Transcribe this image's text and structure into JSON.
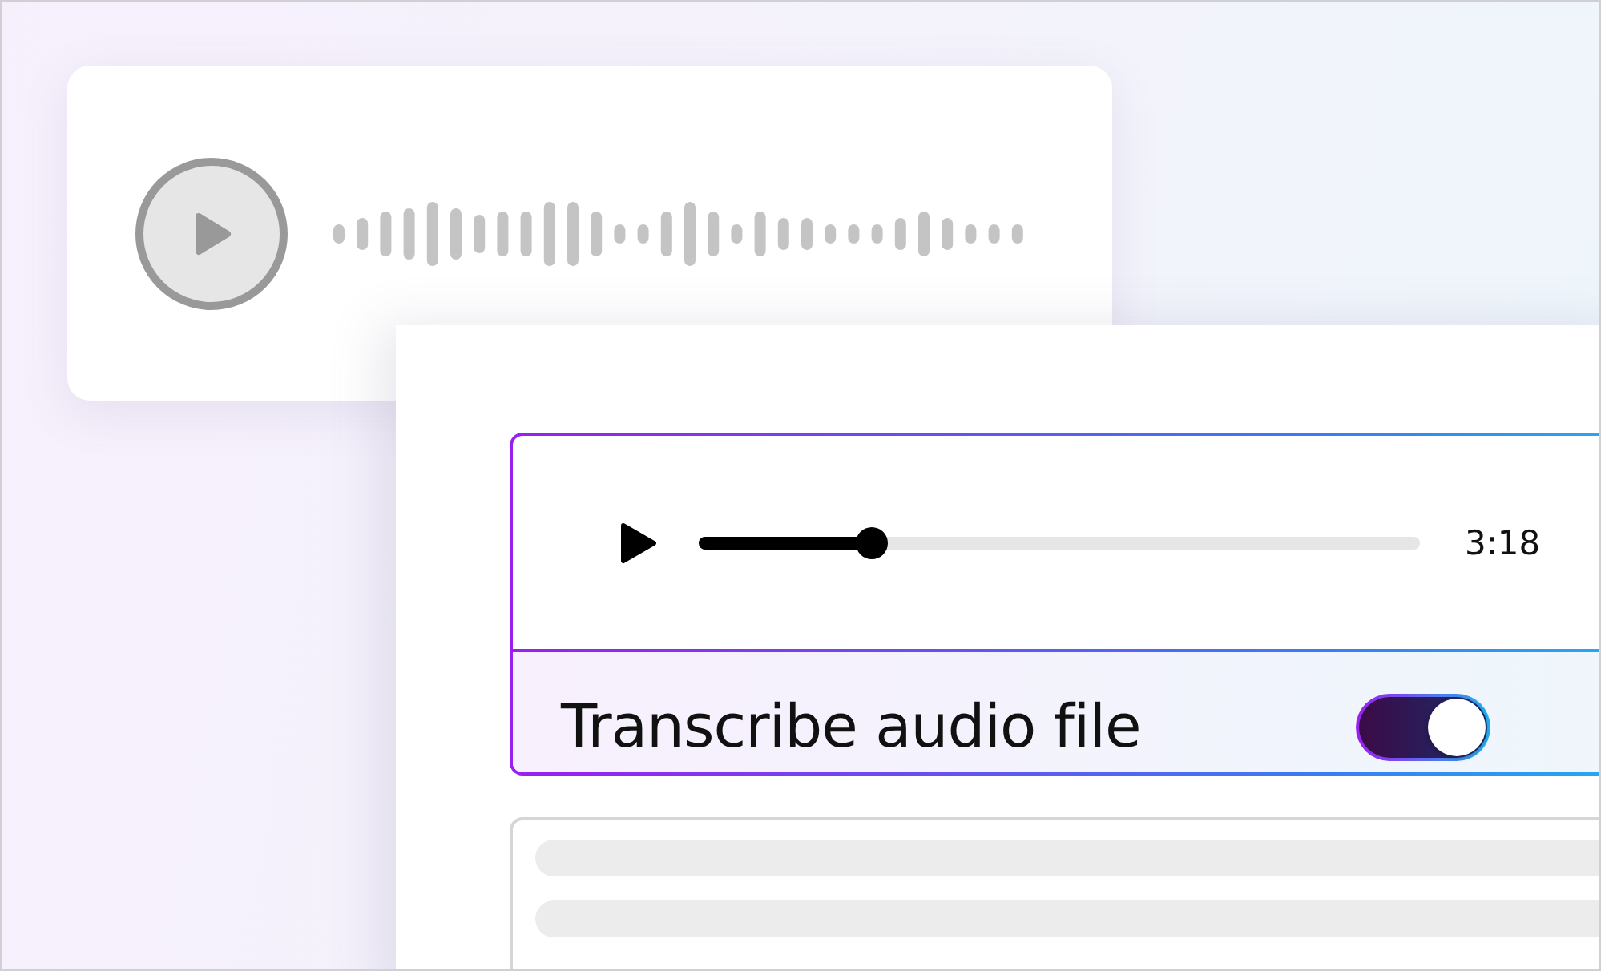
{
  "audio_player": {
    "level": 0.24,
    "duration": "3:18"
  },
  "transcribe": {
    "label": "Transcribe audio file",
    "on": true
  }
}
